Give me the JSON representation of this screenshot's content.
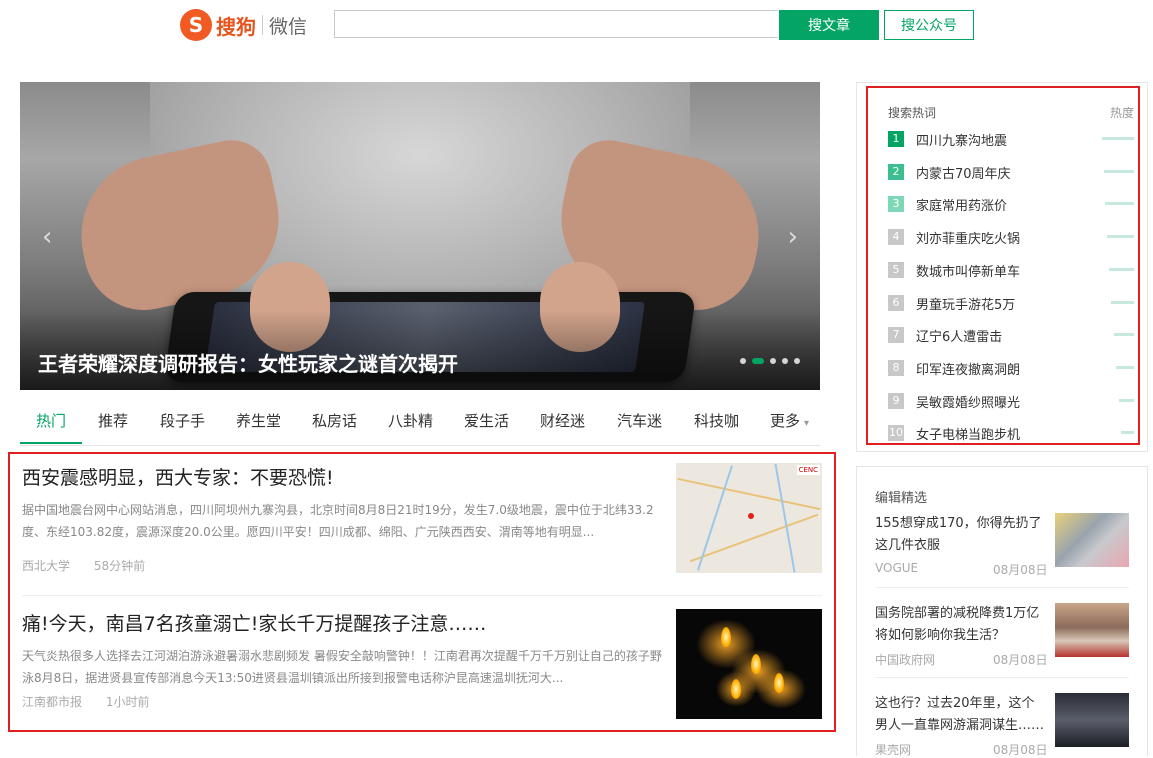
{
  "header": {
    "logo_mark": "S",
    "logo_text": "搜狗",
    "logo_sub": "微信",
    "search_value": "",
    "btn_article": "搜文章",
    "btn_account": "搜公众号"
  },
  "hero": {
    "title": "王者荣耀深度调研报告：女性玩家之谜首次揭开",
    "prev": "‹",
    "next": "›",
    "slide_count": 5,
    "active_slide": 2
  },
  "tabs": {
    "items": [
      "热门",
      "推荐",
      "段子手",
      "养生堂",
      "私房话",
      "八卦精",
      "爱生活",
      "财经迷",
      "汽车迷",
      "科技咖",
      "更多"
    ],
    "active": "热门",
    "more_caret": "▾",
    "accent": "#04a564"
  },
  "articles": [
    {
      "title": "西安震感明显，西大专家：不要恐慌!",
      "summary": "据中国地震台网中心网站消息，四川阿坝州九寨沟县，北京时间8月8日21时19分，发生7.0级地震，震中位于北纬33.2度、东经103.82度，震源深度20.0公里。愿四川平安！四川成都、绵阳、广元陕西西安、渭南等地有明显...",
      "source": "西北大学",
      "time": "58分钟前",
      "thumb_label": "CENC"
    },
    {
      "title": "痛!今天，南昌7名孩童溺亡!家长千万提醒孩子注意……",
      "summary": "天气炎热很多人选择去江河湖泊游泳避暑溺水悲剧频发 暑假安全敲响警钟！！江南君再次提醒千万千万别让自己的孩子野泳8月8日，据进贤县宣传部消息今天13:50进贤县温圳镇派出所接到报警电话称沪昆高速温圳抚河大...",
      "source": "江南都市报",
      "time": "1小时前"
    }
  ],
  "hot_search": {
    "title": "搜索热词",
    "heat_label": "热度",
    "items": [
      {
        "rank": "1",
        "text": "四川九寨沟地震",
        "heat": 100,
        "color": "#04a564"
      },
      {
        "rank": "2",
        "text": "内蒙古70周年庆",
        "heat": 95,
        "color": "#3cbf8e"
      },
      {
        "rank": "3",
        "text": "家庭常用药涨价",
        "heat": 90,
        "color": "#7fd8b5"
      },
      {
        "rank": "4",
        "text": "刘亦菲重庆吃火锅",
        "heat": 85,
        "color": "#c8c8c8"
      },
      {
        "rank": "5",
        "text": "数城市叫停新单车",
        "heat": 78,
        "color": "#c8c8c8"
      },
      {
        "rank": "6",
        "text": "男童玩手游花5万",
        "heat": 72,
        "color": "#c8c8c8"
      },
      {
        "rank": "7",
        "text": "辽宁6人遭雷击",
        "heat": 64,
        "color": "#c8c8c8"
      },
      {
        "rank": "8",
        "text": "印军连夜撤离洞朗",
        "heat": 56,
        "color": "#c8c8c8"
      },
      {
        "rank": "9",
        "text": "吴敏霞婚纱照曝光",
        "heat": 48,
        "color": "#c8c8c8"
      },
      {
        "rank": "10",
        "text": "女子电梯当跑步机",
        "heat": 40,
        "color": "#c8c8c8"
      }
    ]
  },
  "picks": {
    "title": "编辑精选",
    "items": [
      {
        "title": "155想穿成170，你得先扔了这几件衣服",
        "source": "VOGUE",
        "date": "08月08日"
      },
      {
        "title": "国务院部署的减税降费1万亿将如何影响你我生活？",
        "source": "中国政府网",
        "date": "08月08日"
      },
      {
        "title": "这也行？过去20年里，这个男人一直靠网游漏洞谋生……",
        "source": "果壳网",
        "date": "08月08日"
      }
    ]
  }
}
